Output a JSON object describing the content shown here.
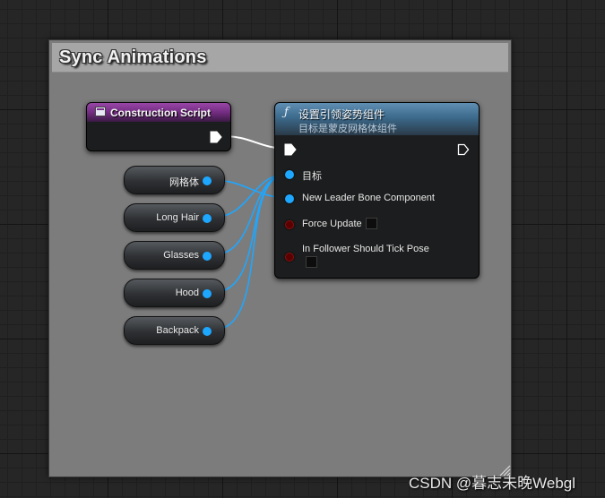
{
  "comment": {
    "title": "Sync Animations"
  },
  "construction_node": {
    "title": "Construction Script"
  },
  "function_node": {
    "icon": "function-f-icon",
    "title": "设置引领姿势组件",
    "subtitle": "目标是蒙皮网格体组件",
    "pins": {
      "target": "目标",
      "new_leader": "New Leader Bone Component",
      "force_update": "Force Update",
      "follower_tick": "In Follower Should Tick Pose"
    }
  },
  "variables": [
    "网格体",
    "Long Hair",
    "Glasses",
    "Hood",
    "Backpack"
  ],
  "colors": {
    "object_pin": "#1ea7ff",
    "bool_pin": "#5a0000",
    "function_header": "#3c6a8c",
    "construction_header": "#7e3590",
    "comment_bg": "#7c7c7c"
  },
  "watermark": "CSDN @暮志未晚Webgl"
}
